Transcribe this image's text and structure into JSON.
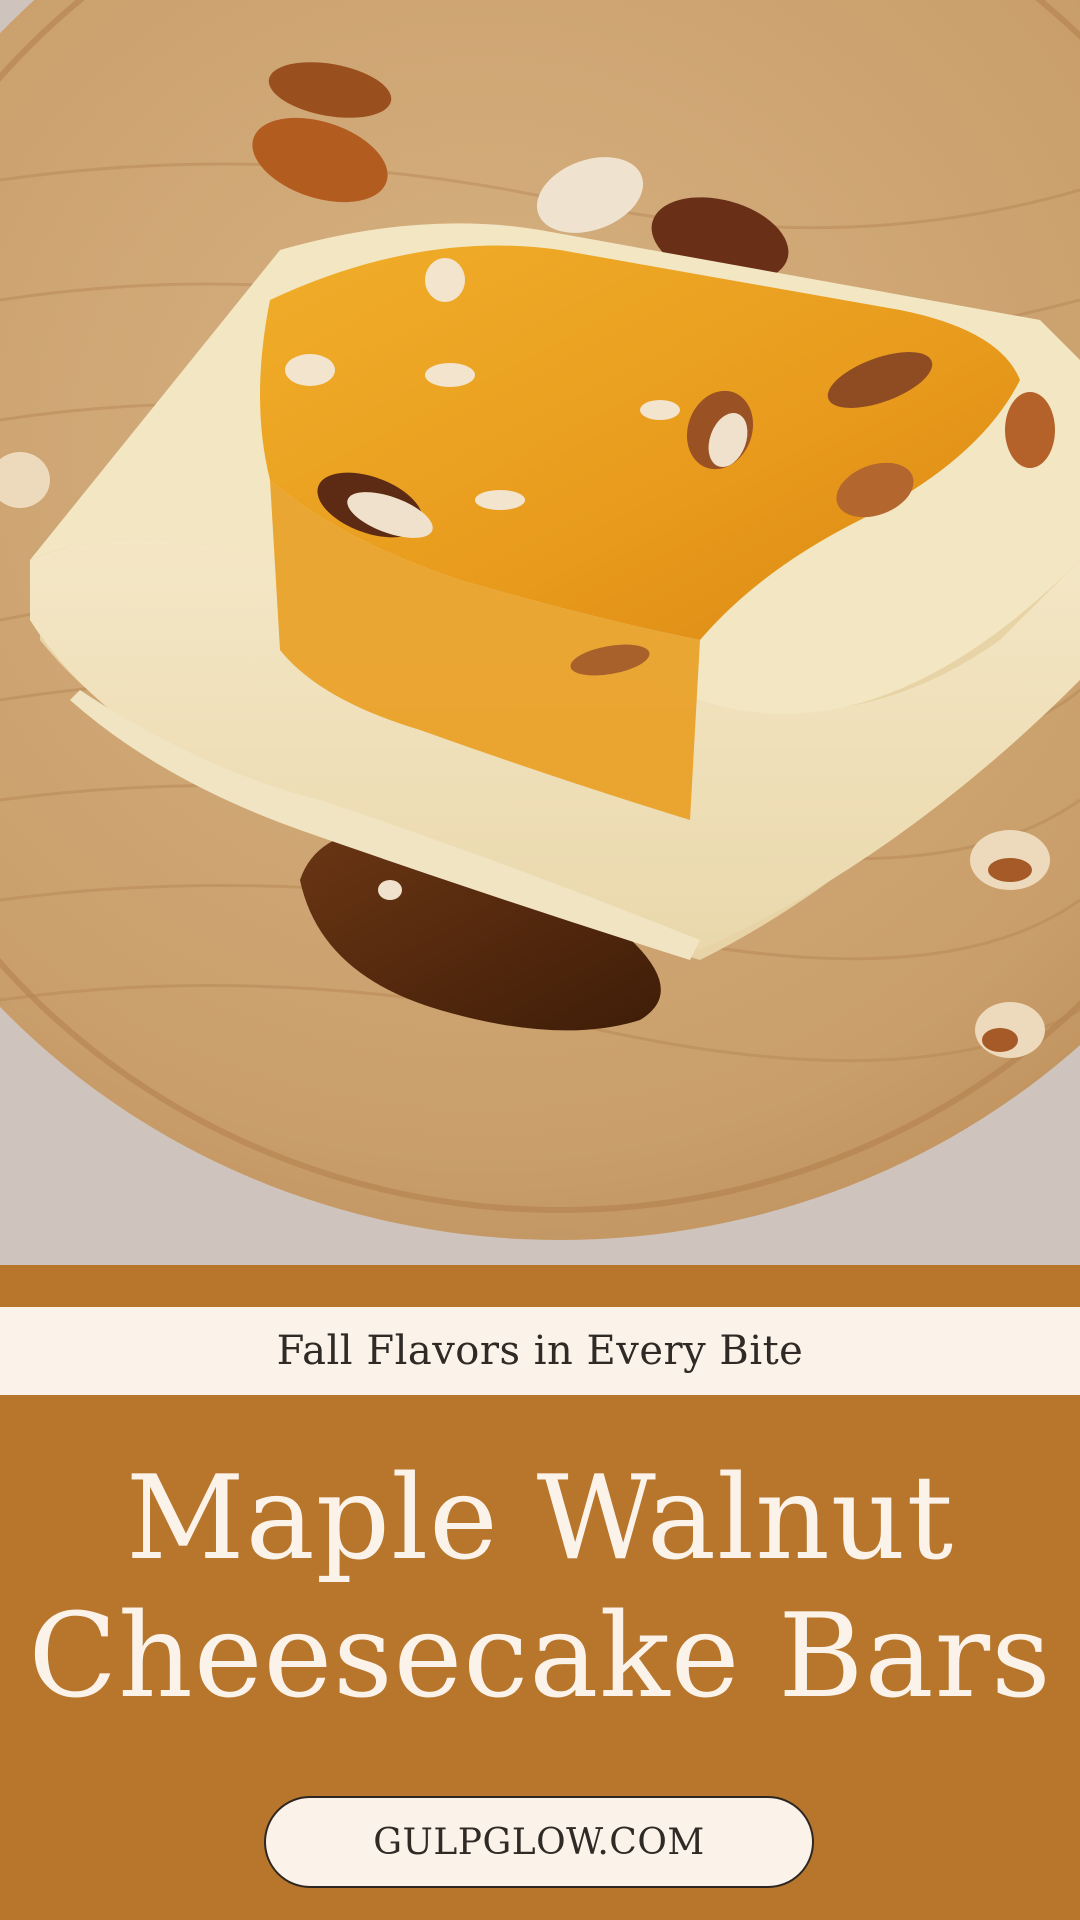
{
  "photo": {
    "subject": "maple walnut cheesecake bar on wooden plate"
  },
  "tagline": "Fall Flavors in Every Bite",
  "title": {
    "line1": "Maple Walnut",
    "line2": "Cheesecake Bars"
  },
  "website": "GULPGLOW.COM",
  "colors": {
    "panel": "#b7762c",
    "cream": "#fbf3ea",
    "text_dark": "#2f2a26"
  }
}
